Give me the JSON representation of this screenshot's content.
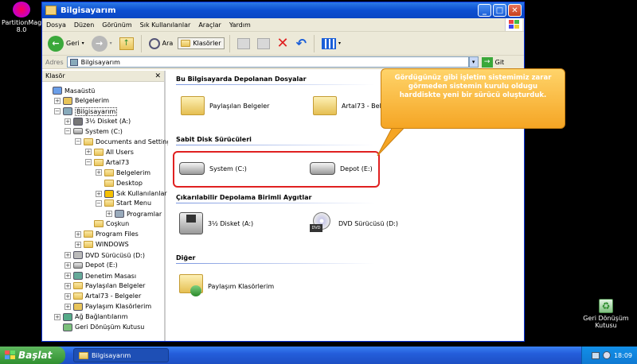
{
  "desktop": {
    "partition_icon_label": "PartitionMag 8.0",
    "recycle_icon_label": "Geri Dönüşüm Kutusu"
  },
  "window": {
    "title": "Bilgisayarım",
    "menu": [
      "Dosya",
      "Düzen",
      "Görünüm",
      "Sık Kullanılanlar",
      "Araçlar",
      "Yardım"
    ],
    "toolbar": {
      "back_label": "Geri",
      "search_label": "Ara",
      "folders_label": "Klasörler"
    },
    "address": {
      "label": "Adres",
      "value": "Bilgisayarım",
      "go_label": "Git"
    }
  },
  "folders_pane": {
    "title": "Klasör",
    "tree": [
      {
        "label": "Masaüstü",
        "level": 0,
        "icon": "desktop-icon",
        "expander": ""
      },
      {
        "label": "Belgelerim",
        "level": 1,
        "icon": "documents-icon",
        "expander": "+"
      },
      {
        "label": "Bilgisayarım",
        "level": 1,
        "icon": "computer-icon",
        "expander": "−",
        "selected": true
      },
      {
        "label": "3½ Disket (A:)",
        "level": 2,
        "icon": "floppy-icon",
        "expander": "+"
      },
      {
        "label": "System (C:)",
        "level": 2,
        "icon": "drive-icon",
        "expander": "−"
      },
      {
        "label": "Documents and Settings",
        "level": 3,
        "icon": "folder-icon",
        "expander": "−"
      },
      {
        "label": "All Users",
        "level": 4,
        "icon": "folder-icon",
        "expander": "+"
      },
      {
        "label": "Artal73",
        "level": 4,
        "icon": "folder-icon",
        "expander": "−"
      },
      {
        "label": "Belgelerim",
        "level": 5,
        "icon": "folder-icon",
        "expander": "+"
      },
      {
        "label": "Desktop",
        "level": 5,
        "icon": "folder-icon",
        "expander": ""
      },
      {
        "label": "Sık Kullanılanlar",
        "level": 5,
        "icon": "favorites-icon",
        "expander": "+"
      },
      {
        "label": "Start Menu",
        "level": 5,
        "icon": "folder-icon",
        "expander": "−"
      },
      {
        "label": "Programlar",
        "level": 6,
        "icon": "programs-icon",
        "expander": "+"
      },
      {
        "label": "Coşkun",
        "level": 4,
        "icon": "folder-icon",
        "expander": ""
      },
      {
        "label": "Program Files",
        "level": 3,
        "icon": "folder-icon",
        "expander": "+"
      },
      {
        "label": "WINDOWS",
        "level": 3,
        "icon": "folder-icon",
        "expander": "+"
      },
      {
        "label": "DVD Sürücüsü (D:)",
        "level": 2,
        "icon": "dvd-icon",
        "expander": "+"
      },
      {
        "label": "Depot (E:)",
        "level": 2,
        "icon": "drive-icon",
        "expander": "+"
      },
      {
        "label": "Denetim Masası",
        "level": 2,
        "icon": "control-panel-icon",
        "expander": "+"
      },
      {
        "label": "Paylaşılan Belgeler",
        "level": 2,
        "icon": "folder-icon",
        "expander": "+"
      },
      {
        "label": "Artal73 - Belgeler",
        "level": 2,
        "icon": "folder-icon",
        "expander": "+"
      },
      {
        "label": "Paylaşım Klasörlerim",
        "level": 2,
        "icon": "share-folder-icon",
        "expander": "+"
      },
      {
        "label": "Ağ Bağlantılarım",
        "level": 1,
        "icon": "network-icon",
        "expander": "+"
      },
      {
        "label": "Geri Dönüşüm Kutusu",
        "level": 1,
        "icon": "recycle-bin-icon",
        "expander": ""
      }
    ]
  },
  "content": {
    "groups": {
      "stored_files": "Bu Bilgisayarda Depolanan Dosyalar",
      "hard_disks": "Sabit Disk Sürücüleri",
      "removable": "Çıkarılabilir Depolama Birimli Aygıtlar",
      "other": "Diğer"
    },
    "items": {
      "shared_docs": "Paylaşılan Belgeler",
      "artal_docs": "Artal73 - Belge",
      "system_c": "System (C:)",
      "depot_e": "Depot (E:)",
      "floppy_a": "3½ Disket (A:)",
      "dvd_d": "DVD Sürücüsü (D:)",
      "share_folders": "Paylaşım Klasörlerim"
    }
  },
  "callout": {
    "text": "Gördügünüz gibi işletim sistemimiz zarar görmeden sistemin kurulu oldugu harddiskte yeni bir sürücü oluşturduk."
  },
  "taskbar": {
    "start_label": "Başlat",
    "task_label": "Bilgisayarım",
    "clock": "18:09"
  },
  "colors": {
    "callout_fill": "#f5a524",
    "highlight_red": "#e02020",
    "titlebar_blue": "#0c4fd1"
  }
}
